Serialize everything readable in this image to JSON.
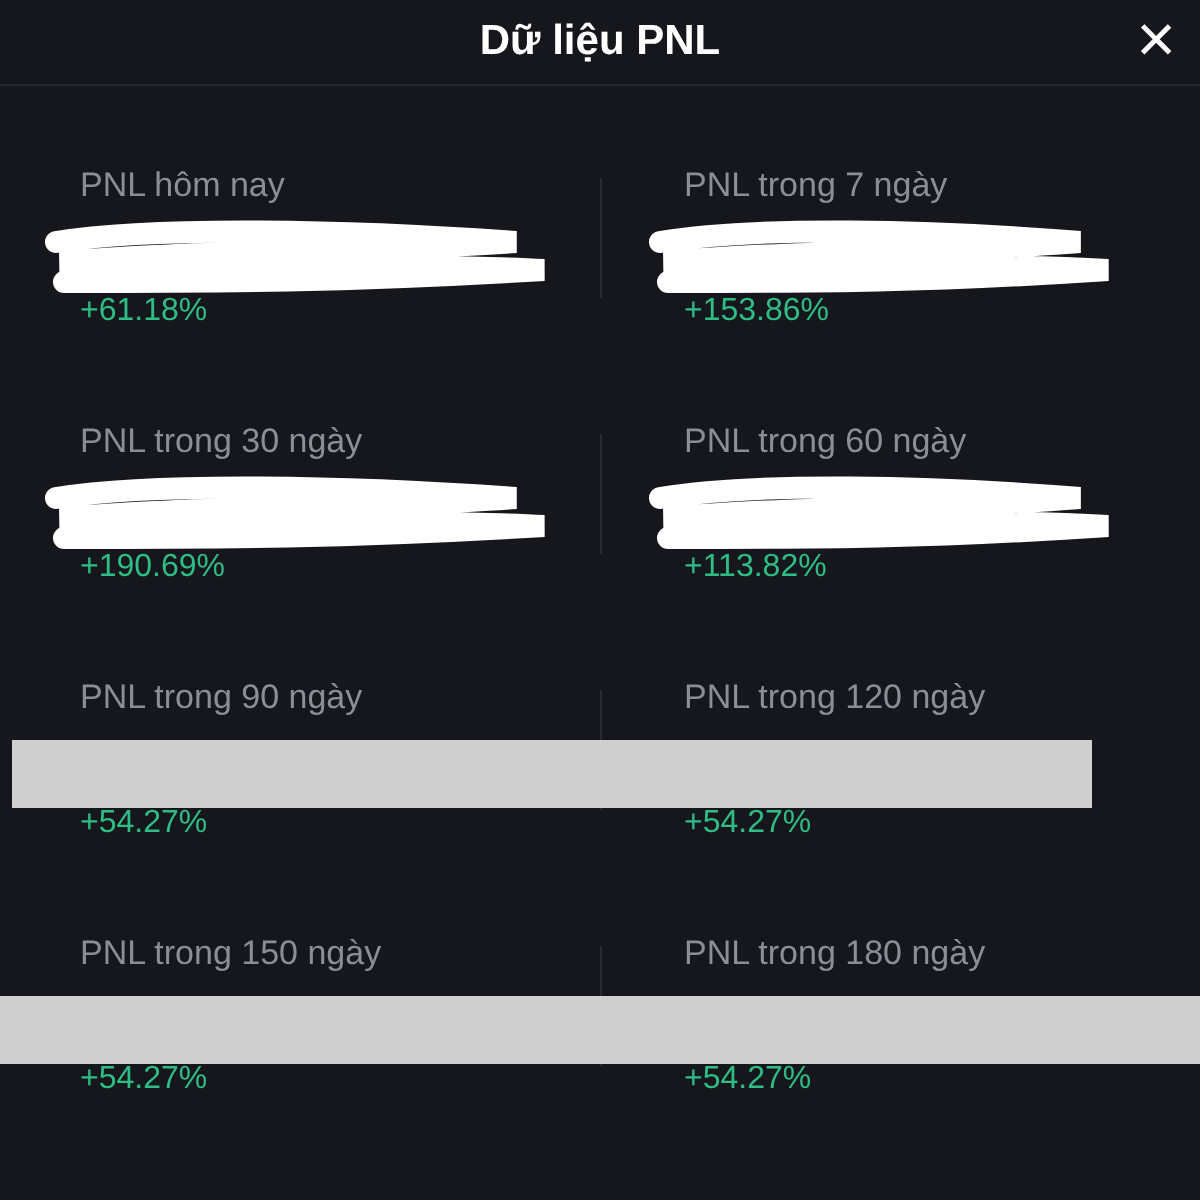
{
  "header": {
    "title": "Dữ liệu PNL",
    "close": "×"
  },
  "rows": [
    {
      "kind": "scribble",
      "cells": [
        {
          "label": "PNL hôm nay",
          "change": "+61.18%"
        },
        {
          "label": "PNL trong 7 ngày",
          "change": "+153.86%"
        }
      ]
    },
    {
      "kind": "scribble",
      "cells": [
        {
          "label": "PNL trong 30 ngày",
          "change": "+190.69%"
        },
        {
          "label": "PNL trong 60 ngày",
          "change": "+113.82%"
        }
      ]
    },
    {
      "kind": "bar",
      "cells": [
        {
          "label": "PNL trong 90 ngày",
          "change": "+54.27%"
        },
        {
          "label": "PNL trong 120 ngày",
          "change": "+54.27%"
        }
      ]
    },
    {
      "kind": "bar",
      "cells": [
        {
          "label": "PNL trong 150 ngày",
          "change": "+54.27%"
        },
        {
          "label": "PNL trong 180 ngày",
          "change": "+54.27%"
        }
      ]
    }
  ]
}
